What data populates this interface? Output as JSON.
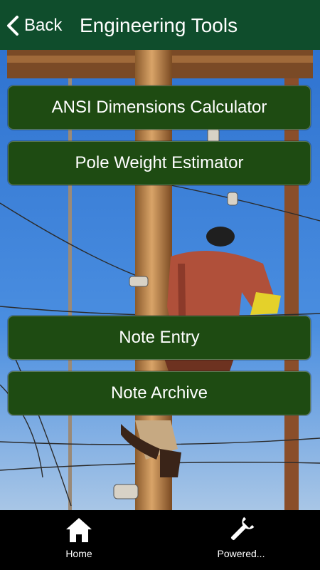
{
  "header": {
    "back_label": "Back",
    "title": "Engineering Tools",
    "background_color": "#0f4d2c"
  },
  "menu": {
    "button_color": "#1e4b12",
    "items": [
      {
        "label": "ANSI Dimensions Calculator"
      },
      {
        "label": "Pole Weight Estimator"
      },
      {
        "label": "Note Entry"
      },
      {
        "label": "Note Archive"
      }
    ]
  },
  "tabbar": {
    "items": [
      {
        "label": "Home",
        "icon": "home-icon"
      },
      {
        "label": "Powered...",
        "icon": "wrench-icon"
      }
    ]
  },
  "background_image": {
    "subject": "lineman climbing utility pole",
    "sky_color": "#3a7fd8"
  }
}
